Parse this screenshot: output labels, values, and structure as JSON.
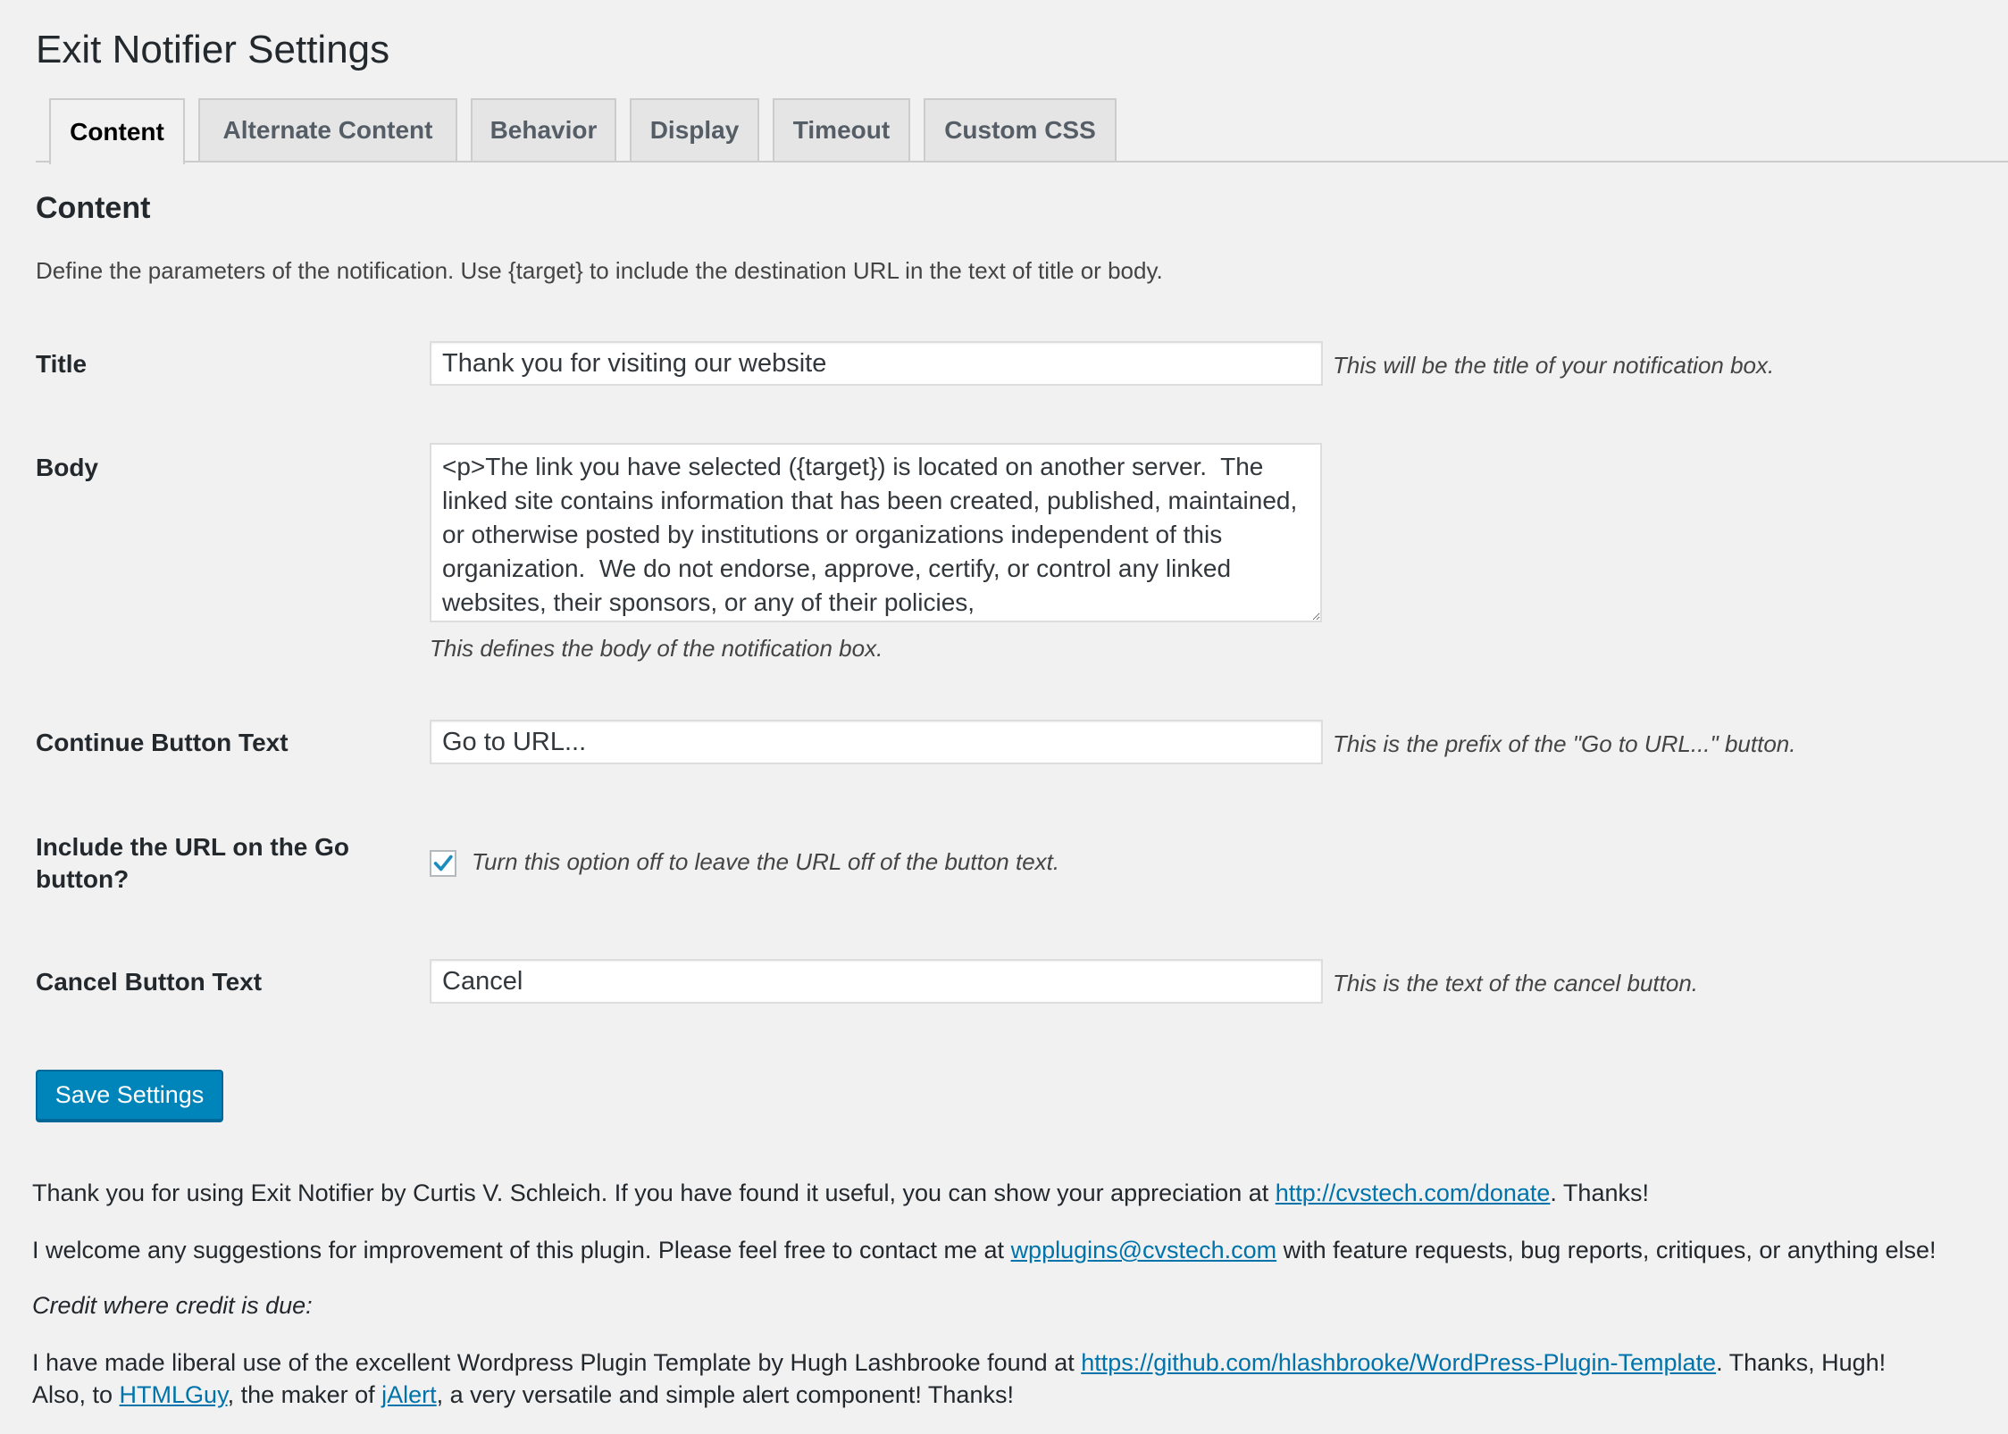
{
  "page": {
    "title": "Exit Notifier Settings"
  },
  "tabs": [
    {
      "label": "Content",
      "active": true
    },
    {
      "label": "Alternate Content",
      "active": false
    },
    {
      "label": "Behavior",
      "active": false
    },
    {
      "label": "Display",
      "active": false
    },
    {
      "label": "Timeout",
      "active": false
    },
    {
      "label": "Custom CSS",
      "active": false
    }
  ],
  "section": {
    "title": "Content",
    "description": "Define the parameters of the notification. Use {target} to include the destination URL in the text of title or body."
  },
  "fields": {
    "title": {
      "label": "Title",
      "value": "Thank you for visiting our website",
      "hint": "This will be the title of your notification box."
    },
    "body": {
      "label": "Body",
      "value": "<p>The link you have selected ({target}) is located on another server.  The linked site contains information that has been created, published, maintained, or otherwise posted by institutions or organizations independent of this organization.  We do not endorse, approve, certify, or control any linked websites, their sponsors, or any of their policies,",
      "hint": "This defines the body of the notification box."
    },
    "continue": {
      "label": "Continue Button Text",
      "value": "Go to URL...",
      "hint": "This is the prefix of the \"Go to URL...\" button."
    },
    "include_url": {
      "label": "Include the URL on the Go button?",
      "checked": true,
      "hint": "Turn this option off to leave the URL off of the button text."
    },
    "cancel": {
      "label": "Cancel Button Text",
      "value": "Cancel",
      "hint": "This is the text of the cancel button."
    }
  },
  "save_button": "Save Settings",
  "footer": {
    "line1_pre": "Thank you for using Exit Notifier by Curtis V. Schleich. If you have found it useful, you can show your appreciation at ",
    "line1_link": "http://cvstech.com/donate",
    "line1_post": ". Thanks!",
    "line2_pre": "I welcome any suggestions for improvement of this plugin. Please feel free to contact me at ",
    "line2_link": "wpplugins@cvstech.com",
    "line2_post": " with feature requests, bug reports, critiques, or anything else!",
    "credit_heading": "Credit where credit is due:",
    "line3_pre": "I have made liberal use of the excellent Wordpress Plugin Template by Hugh Lashbrooke found at ",
    "line3_link": "https://github.com/hlashbrooke/WordPress-Plugin-Template",
    "line3_post": ". Thanks, Hugh!",
    "line4_pre": "Also, to ",
    "line4_link1": "HTMLGuy",
    "line4_mid": ", the maker of ",
    "line4_link2": "jAlert",
    "line4_post": ", a very versatile and simple alert component! Thanks!"
  },
  "colors": {
    "background": "#f1f1f1",
    "primary_button": "#0085ba",
    "link": "#0073aa",
    "checkmark": "#1e8cbe"
  }
}
